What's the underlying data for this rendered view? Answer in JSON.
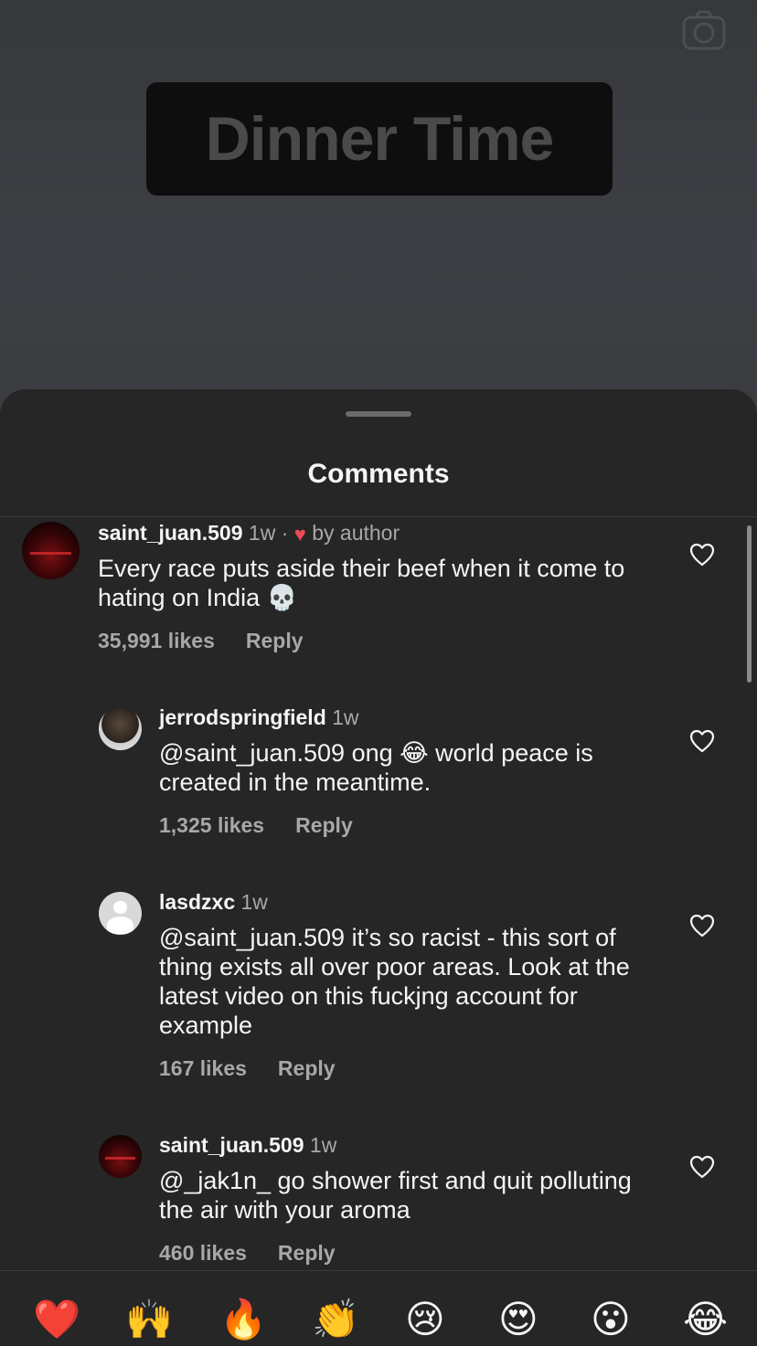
{
  "video": {
    "overlay_text": "Dinner Time",
    "camera_icon": "camera-icon"
  },
  "sheet": {
    "title": "Comments"
  },
  "comments": [
    {
      "username": "saint_juan.509",
      "time": "1w",
      "separator": "·",
      "by_author": "by author",
      "text": "Every race puts aside their beef when it come to hating on India 💀",
      "likes": "35,991 likes",
      "reply": "Reply"
    },
    {
      "username": "jerrodspringfield",
      "time": "1w",
      "mention": "@saint_juan.509",
      "text": " ong 😂 world peace is created in the meantime.",
      "likes": "1,325 likes",
      "reply": "Reply"
    },
    {
      "username": "lasdzxc",
      "time": "1w",
      "mention": "@saint_juan.509",
      "text": " it’s so racist - this sort of thing exists all over poor areas. Look at the latest video on this fuckjng account for example",
      "likes": "167 likes",
      "reply": "Reply"
    },
    {
      "username": "saint_juan.509",
      "time": "1w",
      "mention": "@_jak1n_",
      "text": " go shower first and quit polluting the air with your aroma",
      "likes": "460 likes",
      "reply": "Reply"
    }
  ],
  "emoji_bar": [
    "❤️",
    "🙌",
    "🔥",
    "👏",
    "😢",
    "😍",
    "😮",
    "😂"
  ],
  "colors": {
    "sheet_bg": "#262626",
    "secondary_text": "#a8a8a8",
    "author_heart": "#ed4956"
  }
}
